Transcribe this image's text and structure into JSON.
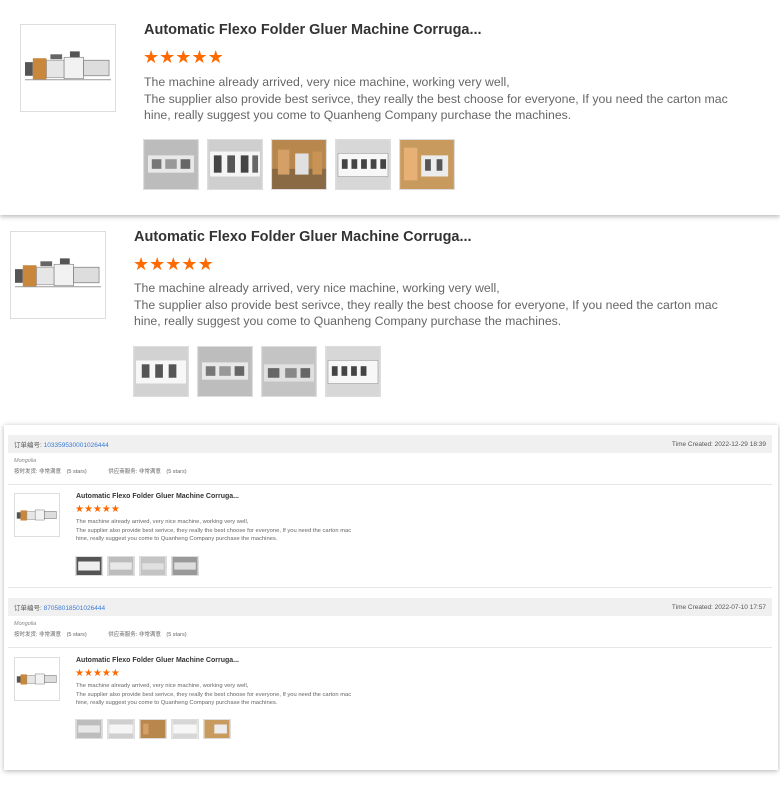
{
  "review_panels": [
    {
      "product_title": "Automatic Flexo Folder Gluer Machine Corruga...",
      "rating_stars": 5,
      "review_lines": [
        "The machine already arrived, very nice machine, working very well,",
        "The supplier also provide best serivce, they really the best choose for everyone, If you need the carton mac",
        "hine, really suggest you come to Quanheng Company purchase the machines."
      ],
      "photo_count": 5
    },
    {
      "product_title": "Automatic Flexo Folder Gluer Machine Corruga...",
      "rating_stars": 5,
      "review_lines": [
        "The machine already arrived, very nice machine, working very well,",
        "The supplier also provide best serivce, they really the best choose for everyone, If you need the carton mac",
        "hine, really suggest you come to Quanheng Company purchase the machines."
      ],
      "photo_count": 4
    }
  ],
  "orders": [
    {
      "order_label": "订单编号:",
      "order_number": "103359530001026444",
      "time_created": "Time Created: 2022-12-29 18:39",
      "buyer": "Mongolia",
      "ship_label": "按时发货: 非常满意",
      "ship_stars": "(5 stars)",
      "service_label": "供应商服务: 非常满意",
      "service_stars": "(5 stars)",
      "product_title": "Automatic Flexo Folder Gluer Machine Corruga...",
      "rating_stars": 5,
      "review_lines": [
        "The machine already arrived, very nice machine, working very well,",
        "The supplier also provide best serivce, they really the best choose for everyone, If you need the carton mac",
        "hine, really suggest you come to Quanheng Company purchase the machines."
      ],
      "photo_count": 4
    },
    {
      "order_label": "订单编号:",
      "order_number": "87058018501026444",
      "time_created": "Time Created: 2022-07-10 17:57",
      "buyer": "Mongolia",
      "ship_label": "按时发货: 非常满意",
      "ship_stars": "(5 stars)",
      "service_label": "供应商服务: 非常满意",
      "service_stars": "(5 stars)",
      "product_title": "Automatic Flexo Folder Gluer Machine Corruga...",
      "rating_stars": 5,
      "review_lines": [
        "The machine already arrived, very nice machine, working very well,",
        "The supplier also provide best serivce, they really the best choose for everyone, If you need the carton mac",
        "hine, really suggest you come to Quanheng Company purchase the machines."
      ],
      "photo_count": 5
    }
  ],
  "icons": {
    "star": "star-icon",
    "product": "machine-image-icon",
    "photo": "review-photo-icon"
  },
  "colors": {
    "star": "#ff6a00",
    "order_link": "#3a7bd5",
    "header_bg": "#f0f0f0"
  }
}
